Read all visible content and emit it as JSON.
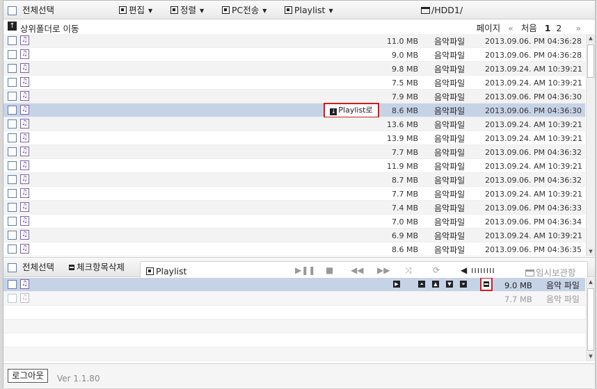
{
  "toolbar": {
    "select_all": "전체선택",
    "edit": "편집",
    "sort": "정렬",
    "pc_transfer": "PC전송",
    "playlist": "Playlist",
    "path": "/HDD1/"
  },
  "nav": {
    "up_label": "상위폴더로 이동",
    "page_label": "페이지",
    "first_label": "처음",
    "pages": [
      "1",
      "2"
    ],
    "current_page": "1",
    "prev_arrows": "«",
    "next_arrows": "»"
  },
  "files": [
    {
      "size": "11.0 MB",
      "type": "음악파일",
      "date": "2013.09.06. PM 04:36:28"
    },
    {
      "size": "9.0 MB",
      "type": "음악파일",
      "date": "2013.09.06. PM 04:36:28"
    },
    {
      "size": "9.8 MB",
      "type": "음악파일",
      "date": "2013.09.24. AM 10:39:21"
    },
    {
      "size": "7.5 MB",
      "type": "음악파일",
      "date": "2013.09.24. AM 10:39:21"
    },
    {
      "size": "7.9 MB",
      "type": "음악파일",
      "date": "2013.09.06. PM 04:36:30"
    },
    {
      "size": "8.6 MB",
      "type": "음악파일",
      "date": "2013.09.06. PM 04:36:30",
      "selected": true,
      "action": "Playlist로"
    },
    {
      "size": "13.6 MB",
      "type": "음악파일",
      "date": "2013.09.24. AM 10:39:21"
    },
    {
      "size": "13.9 MB",
      "type": "음악파일",
      "date": "2013.09.24. AM 10:39:21"
    },
    {
      "size": "7.7 MB",
      "type": "음악파일",
      "date": "2013.09.06. PM 04:36:32"
    },
    {
      "size": "11.9 MB",
      "type": "음악파일",
      "date": "2013.09.24. AM 10:39:21"
    },
    {
      "size": "8.7 MB",
      "type": "음악파일",
      "date": "2013.09.06. PM 04:36:32"
    },
    {
      "size": "7.7 MB",
      "type": "음악파일",
      "date": "2013.09.24. AM 10:39:21"
    },
    {
      "size": "7.4 MB",
      "type": "음악파일",
      "date": "2013.09.06. PM 04:36:33"
    },
    {
      "size": "7.0 MB",
      "type": "음악파일",
      "date": "2013.09.06. PM 04:36:34"
    },
    {
      "size": "6.9 MB",
      "type": "음악파일",
      "date": "2013.09.24. AM 10:39:21"
    },
    {
      "size": "8.6 MB",
      "type": "음악파일",
      "date": "2013.09.06. PM 04:36:35"
    }
  ],
  "playlist_bar": {
    "select_all": "전체선택",
    "delete_checked": "체크항목삭제",
    "tab_title": "Playlist",
    "temp_storage": "임시보관함",
    "volume": "◀ ıııııııı"
  },
  "playlist_items": [
    {
      "size": "9.0 MB",
      "type": "음악 파일",
      "selected": true
    },
    {
      "size": "7.7 MB",
      "type": "음악 파일",
      "selected": false
    }
  ],
  "footer": {
    "logout": "로그아웃",
    "version": "Ver 1.1.80"
  },
  "colors": {
    "selected_row": "#c6d3e7",
    "highlight_border": "#d9181e",
    "music_icon": "#6a4b96"
  }
}
